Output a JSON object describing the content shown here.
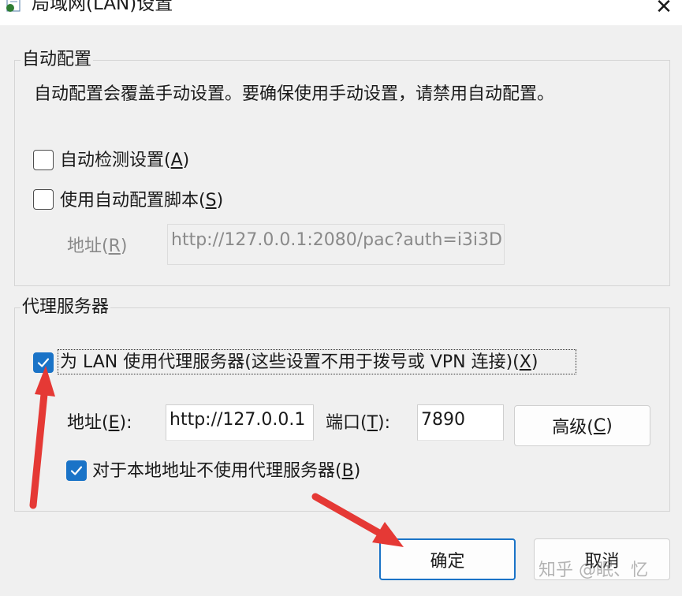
{
  "window": {
    "title": "局域网(LAN)设置",
    "close_icon": "close-icon"
  },
  "auto_config": {
    "group_label": "自动配置",
    "description": "自动配置会覆盖手动设置。要确保使用手动设置，请禁用自动配置。",
    "auto_detect": {
      "label_prefix": "自动检测设置(",
      "mnemonic": "A",
      "label_suffix": ")",
      "checked": false
    },
    "use_script": {
      "label_prefix": "使用自动配置脚本(",
      "mnemonic": "S",
      "label_suffix": ")",
      "checked": false
    },
    "address_label_prefix": "地址(",
    "address_mnemonic": "R",
    "address_label_suffix": ")",
    "address_value": "http://127.0.0.1:2080/pac?auth=i3i3D"
  },
  "proxy": {
    "group_label": "代理服务器",
    "use_proxy": {
      "label_prefix": "为 LAN 使用代理服务器(这些设置不用于拨号或 VPN 连接)(",
      "mnemonic": "X",
      "label_suffix": ")",
      "checked": true
    },
    "address_label_prefix": "地址(",
    "address_mnemonic": "E",
    "address_label_suffix": "):",
    "address_value": "http://127.0.0.1",
    "port_label_prefix": "端口(",
    "port_mnemonic": "T",
    "port_label_suffix": "):",
    "port_value": "7890",
    "advanced_prefix": "高级(",
    "advanced_mnemonic": "C",
    "advanced_suffix": ")",
    "bypass_local": {
      "label_prefix": "对于本地地址不使用代理服务器(",
      "mnemonic": "B",
      "label_suffix": ")",
      "checked": true
    }
  },
  "buttons": {
    "ok": "确定",
    "cancel": "取消"
  },
  "watermark": "知乎 @眠、忆",
  "colors": {
    "accent": "#1a73c7",
    "annotation_arrow": "#e53935"
  }
}
